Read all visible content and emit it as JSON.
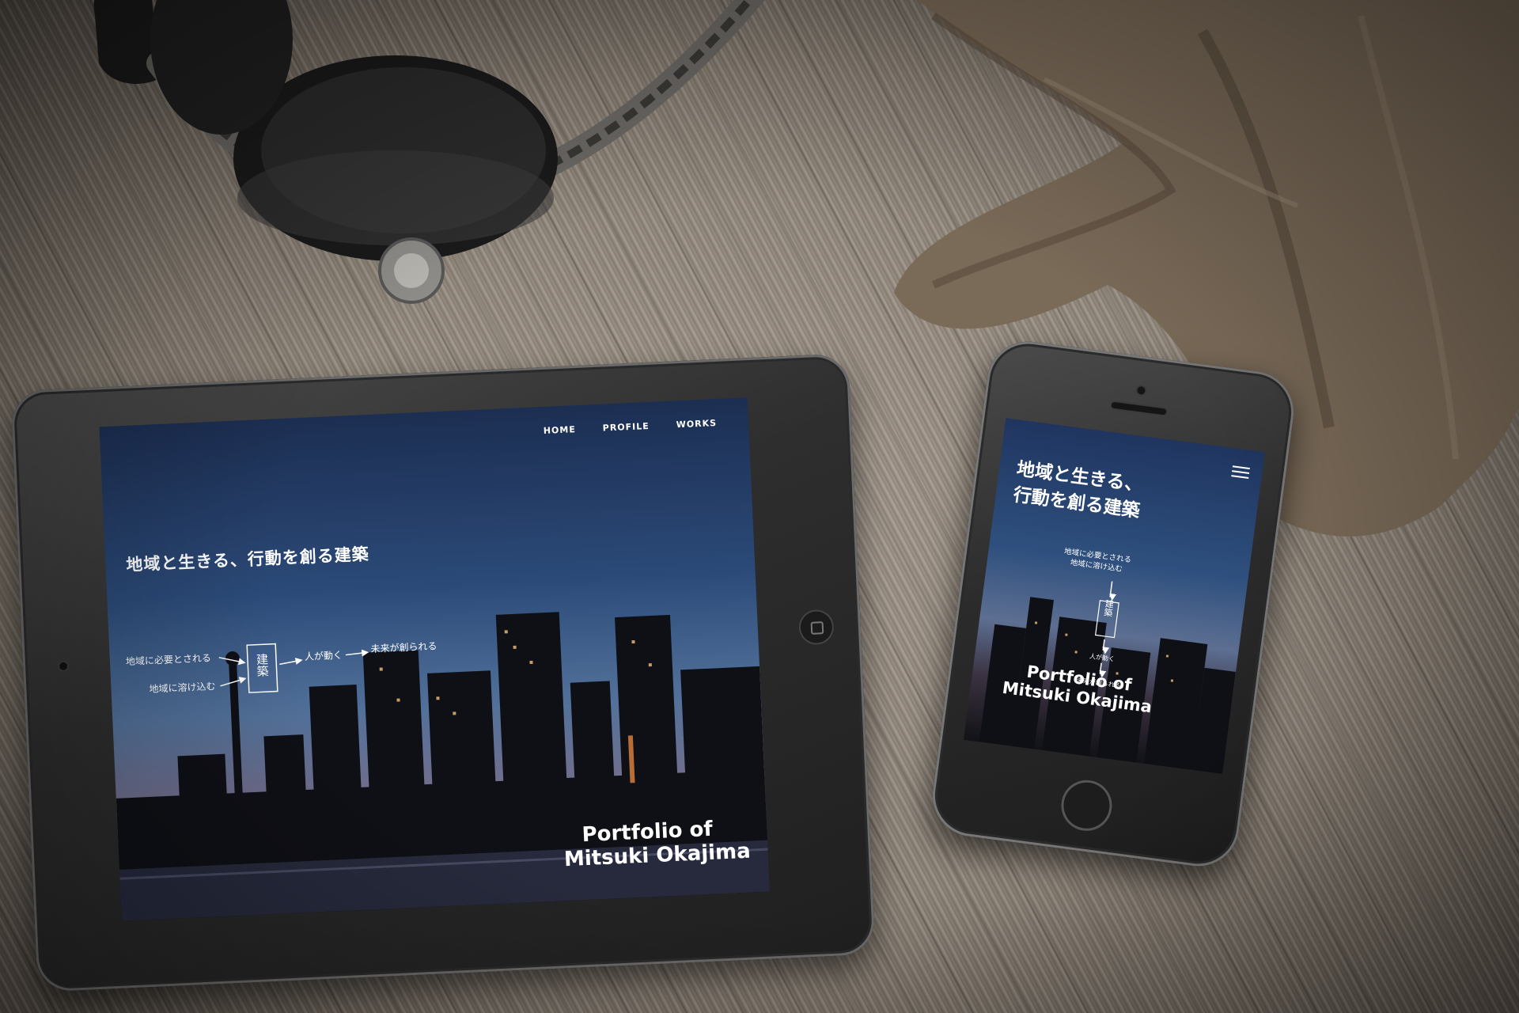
{
  "tablet": {
    "nav": [
      "HOME",
      "PROFILE",
      "WORKS"
    ],
    "headline": "地域と生きる、行動を創る建築",
    "flow": {
      "input_top": "地域に必要とされる",
      "input_bottom": "地域に溶け込む",
      "center": "建築",
      "step1": "人が動く",
      "step2": "未来が創られる"
    },
    "portfolio_line1": "Portfolio of",
    "portfolio_line2": "Mitsuki Okajima"
  },
  "phone": {
    "headline_line1": "地域と生きる、",
    "headline_line2": "行動を創る建築",
    "sub_line1": "地域に必要とされる",
    "sub_line2": "地域に溶け込む",
    "center": "建築",
    "step1": "人が動く",
    "step2": "未来が創られる",
    "portfolio_line1": "Portfolio of",
    "portfolio_line2": "Mitsuki Okajima",
    "menu_icon": "hamburger-menu-icon"
  },
  "colors": {
    "wood": "#8e8478",
    "screen_sky": "#2b4a78",
    "device": "#2e2e2e"
  }
}
